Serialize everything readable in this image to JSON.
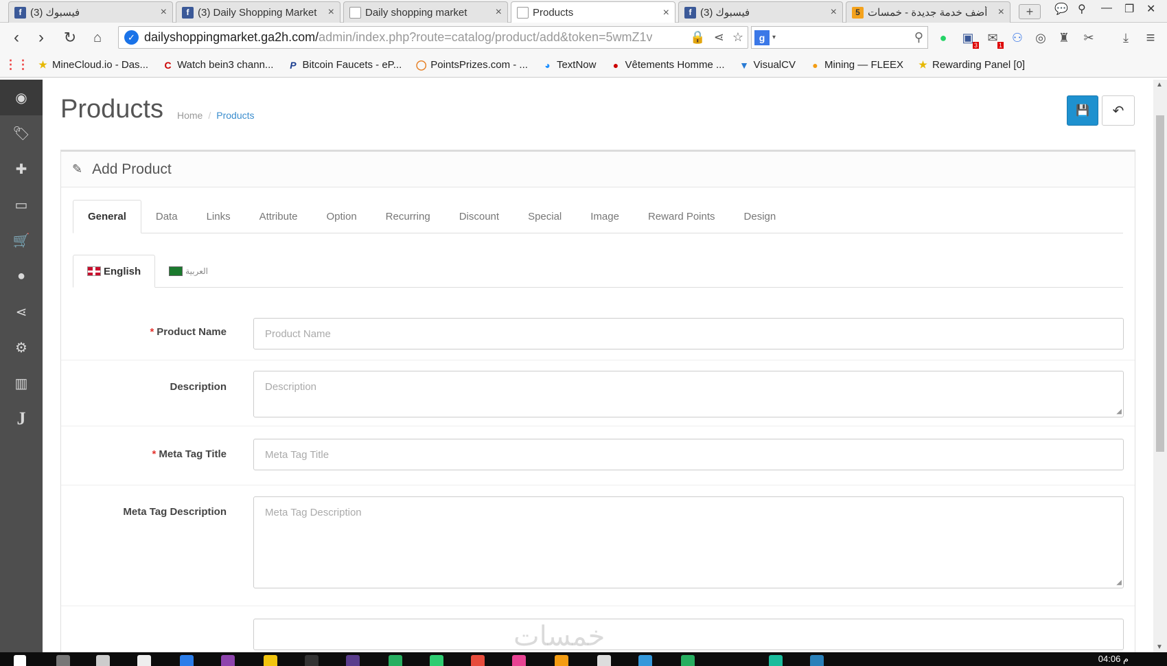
{
  "browser": {
    "tabs": [
      {
        "title": "(3) فيسبوك",
        "icon": "facebook-icon"
      },
      {
        "title": "(3) Daily Shopping Market",
        "icon": "facebook-icon"
      },
      {
        "title": "Daily shopping market",
        "icon": "page-icon"
      },
      {
        "title": "Products",
        "icon": "page-icon"
      },
      {
        "title": "(3) فيسبوك",
        "icon": "facebook-icon"
      },
      {
        "title": "أضف خدمة جديدة - خمسات",
        "icon": "khamsat-icon",
        "favicon_text": "5"
      }
    ],
    "url_host": "dailyshoppingmarket.ga2h.com/",
    "url_path": "admin/index.php?route=catalog/product/add&token=5wmZ1v",
    "bookmarks": [
      {
        "label": "MineCloud.io - Das...",
        "icon": "star-icon"
      },
      {
        "label": "Watch bein3 chann...",
        "icon": "c-logo-icon",
        "glyph": "C"
      },
      {
        "label": "Bitcoin Faucets - eP...",
        "icon": "p-logo-icon",
        "glyph": "P"
      },
      {
        "label": "PointsPrizes.com - ...",
        "icon": "ring-icon"
      },
      {
        "label": "TextNow",
        "icon": "textnow-icon"
      },
      {
        "label": "Vêtements Homme ...",
        "icon": "clothing-icon"
      },
      {
        "label": "VisualCV",
        "icon": "filter-icon"
      },
      {
        "label": "Mining — FLEEX",
        "icon": "coin-icon"
      },
      {
        "label": "Rewarding Panel [0]",
        "icon": "star-icon"
      }
    ],
    "ext_badges": {
      "facebook": "3",
      "mail": "1"
    }
  },
  "sidebar": {
    "items": [
      {
        "name": "dashboard",
        "glyph": "◉"
      },
      {
        "name": "catalog",
        "glyph": "🏷"
      },
      {
        "name": "extensions",
        "glyph": "✚"
      },
      {
        "name": "design",
        "glyph": "▭"
      },
      {
        "name": "sales",
        "glyph": "🛒"
      },
      {
        "name": "customers",
        "glyph": "●"
      },
      {
        "name": "marketing",
        "glyph": "⋖"
      },
      {
        "name": "system",
        "glyph": "⚙"
      },
      {
        "name": "reports",
        "glyph": "▥"
      },
      {
        "name": "j-extension",
        "glyph": "J"
      }
    ]
  },
  "page": {
    "title": "Products",
    "breadcrumb": {
      "home": "Home",
      "sep": "/",
      "current": "Products"
    },
    "panel_title": "Add Product"
  },
  "tabs": [
    "General",
    "Data",
    "Links",
    "Attribute",
    "Option",
    "Recurring",
    "Discount",
    "Special",
    "Image",
    "Reward Points",
    "Design"
  ],
  "language_tabs": {
    "english": "English",
    "arabic": "العربية"
  },
  "form": {
    "product_name": {
      "label": "Product Name",
      "placeholder": "Product Name",
      "required": true
    },
    "description": {
      "label": "Description",
      "placeholder": "Description",
      "required": false
    },
    "meta_title": {
      "label": "Meta Tag Title",
      "placeholder": "Meta Tag Title",
      "required": true
    },
    "meta_description": {
      "label": "Meta Tag Description",
      "placeholder": "Meta Tag Description",
      "required": false
    },
    "required_mark": "*"
  },
  "watermark": "خمسات",
  "taskbar": {
    "clock": "04:06 م"
  },
  "colors": {
    "primary": "#1e91cf",
    "sidebar": "#4e4e4e",
    "required": "#e3342f",
    "link": "#3a8dce"
  }
}
